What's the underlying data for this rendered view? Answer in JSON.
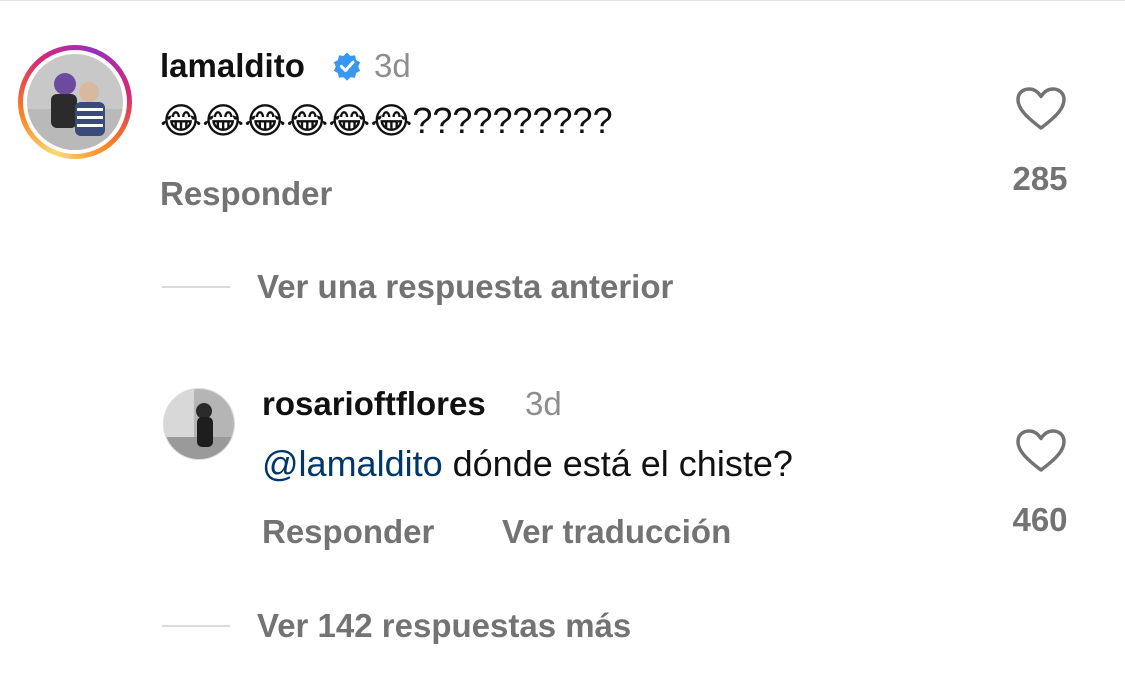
{
  "comments": [
    {
      "username": "lamaldito",
      "verified": true,
      "time": "3d",
      "text": "😂😂😂😂😂😂??????????",
      "reply_label": "Responder",
      "likes": "285"
    },
    {
      "username": "rosarioftflores",
      "verified": false,
      "time": "3d",
      "mention": "@lamaldito",
      "text": " dónde está el chiste?",
      "reply_label": "Responder",
      "translate_label": "Ver traducción",
      "likes": "460"
    }
  ],
  "threads": {
    "previous_reply": "Ver una respuesta anterior",
    "more_replies": "Ver 142 respuestas más"
  },
  "colors": {
    "verified_badge": "#3897f0",
    "mention": "#00376b",
    "secondary_text": "#737373"
  }
}
